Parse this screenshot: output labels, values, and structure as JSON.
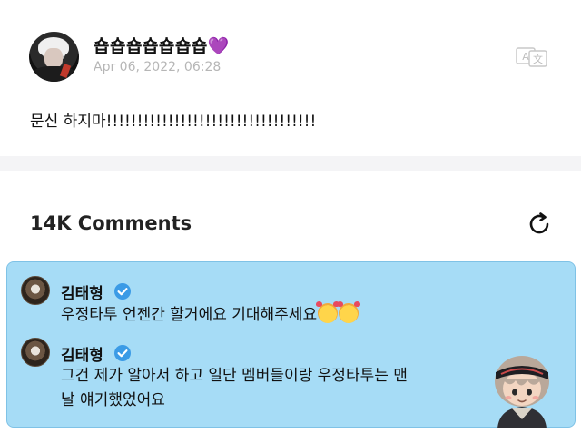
{
  "post": {
    "author": "숍숍숍숍숍숍숍💜",
    "date": "Apr 06, 2022, 06:28",
    "body": "문신 하지마!!!!!!!!!!!!!!!!!!!!!!!!!!!!!!!!!!",
    "translate_icon": "translate-icon"
  },
  "comments": {
    "title": "14K Comments",
    "refresh_icon": "refresh-icon",
    "items": [
      {
        "name": "김태형",
        "text": "우정타투 언젠간 할거에요 기대해주세요"
      },
      {
        "name": "김태형",
        "line1": "그건 제가 알아서 하고 일단 멤버들이랑 우정타투는 맨",
        "line2": "날 얘기했었어요"
      }
    ]
  },
  "colors": {
    "panel_bg": "#a6dcf6",
    "verified": "#3b9be6",
    "date": "#b6b6b6"
  }
}
